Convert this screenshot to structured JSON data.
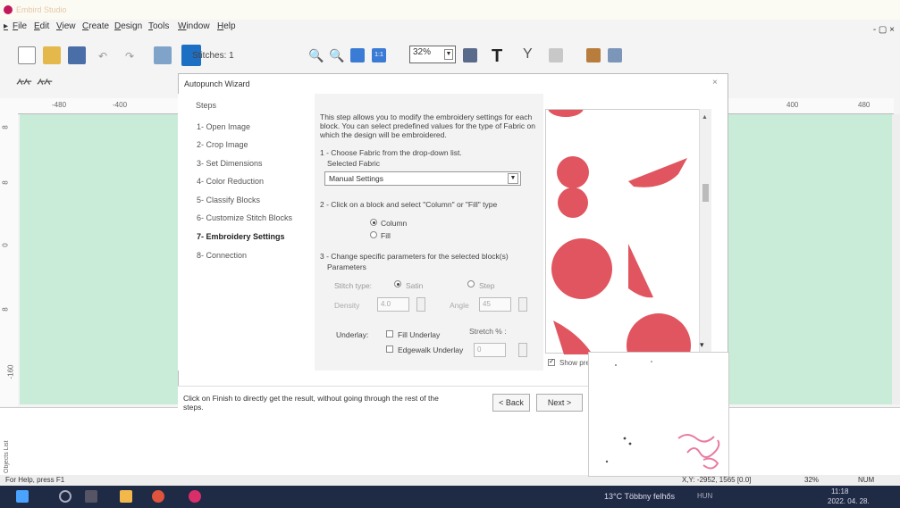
{
  "window": {
    "title": "Embird Studio",
    "controls": "- ▢ ×"
  },
  "menu": [
    "File",
    "Edit",
    "View",
    "Create",
    "Design",
    "Tools",
    "Window",
    "Help"
  ],
  "toolbar": {
    "stitches_label": "Stitches: 1",
    "zoom_value": "32%"
  },
  "ruler": {
    "ticks": [
      "-480",
      "-400",
      "400",
      "480"
    ]
  },
  "vruler": {
    "ticks": [
      "8",
      "8",
      "0",
      "8",
      "-160"
    ]
  },
  "wizard": {
    "title": "Autopunch Wizard",
    "close": "×",
    "steps_header": "Steps",
    "steps": [
      "1- Open Image",
      "2- Crop Image",
      "3- Set Dimensions",
      "4- Color Reduction",
      "5- Classify Blocks",
      "6- Customize Stitch Blocks",
      "7- Embroidery Settings",
      "8- Connection"
    ],
    "active_step_index": 6,
    "intro": "This step allows you to modify the embroidery settings for each block. You can select predefined values for the type of Fabric on which the design will be embroidered.",
    "step1_label": "1 - Choose Fabric from the drop-down list.",
    "selected_fabric_label": "Selected Fabric",
    "selected_fabric_value": "Manual Settings",
    "step2_label": "2 - Click on a block and select \"Column\" or \"Fill\" type",
    "column_label": "Column",
    "fill_label": "Fill",
    "step3_label": "3 - Change specific parameters for the selected block(s)",
    "parameters_label": "Parameters",
    "stitch_type_label": "Stitch type:",
    "satin_label": "Satin",
    "step_label": "Step",
    "density_label": "Density",
    "density_value": "4.0",
    "angle_label": "Angle",
    "angle_value": "45",
    "underlay_label": "Underlay:",
    "fill_underlay_label": "Fill Underlay",
    "edgewalk_underlay_label": "Edgewalk Underlay",
    "stretch_label": "Stretch % :",
    "stretch_value": "0",
    "show_preview_label": "Show pre",
    "footer_text": "Click on Finish to directly get the result, without going through the rest of the steps.",
    "back_button": "< Back",
    "next_button": "Next >"
  },
  "preview_popup": {
    "signature": "Kral"
  },
  "status": {
    "help": "For Help, press F1",
    "xy": "X,Y: -2952, 1565 [0.0]",
    "zoom": "32%",
    "num": "NUM"
  },
  "taskbar": {
    "weather": "13°C Többny felhős",
    "tray": "HUN",
    "time": "11:18",
    "date": "2022. 04. 28."
  },
  "side_tab_label": "Objects List"
}
